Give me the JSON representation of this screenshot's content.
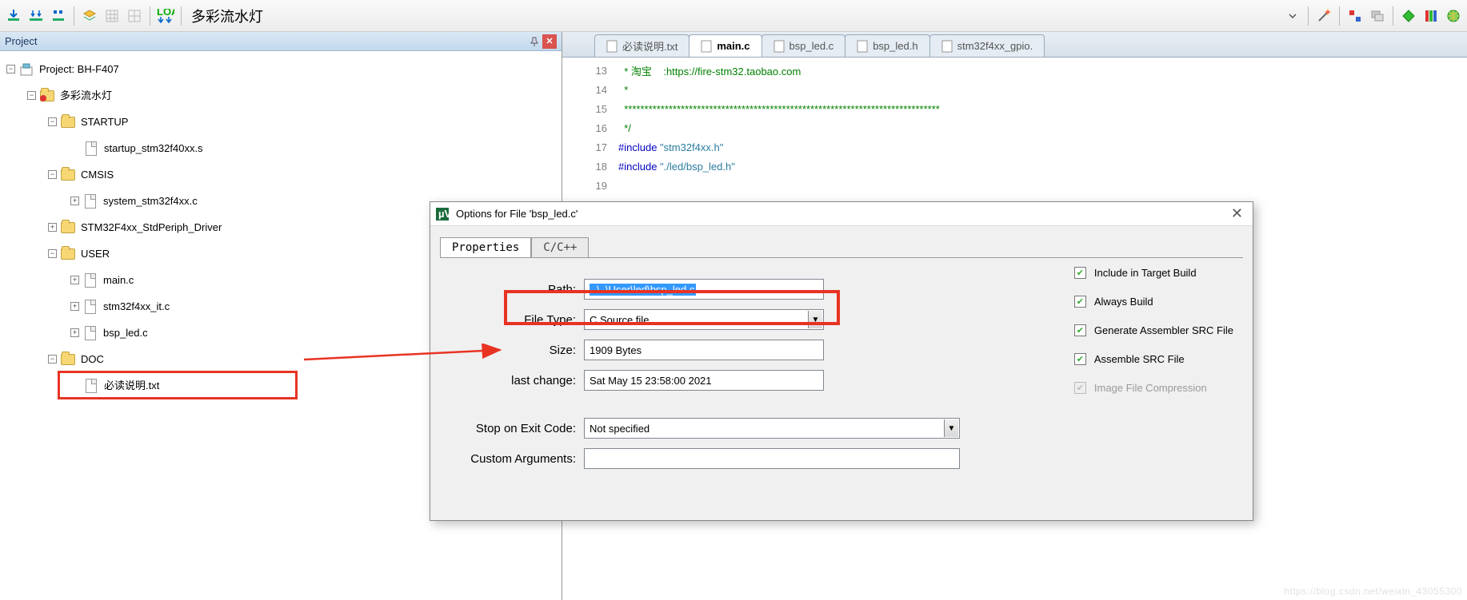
{
  "toolbar": {
    "title": "多彩流水灯"
  },
  "project": {
    "panel_title": "Project",
    "root": "Project: BH-F407",
    "target": "多彩流水灯",
    "groups": {
      "startup": {
        "name": "STARTUP",
        "files": [
          "startup_stm32f40xx.s"
        ]
      },
      "cmsis": {
        "name": "CMSIS",
        "files": [
          "system_stm32f4xx.c"
        ]
      },
      "stdperiph": {
        "name": "STM32F4xx_StdPeriph_Driver"
      },
      "user": {
        "name": "USER",
        "files": [
          "main.c",
          "stm32f4xx_it.c",
          "bsp_led.c"
        ]
      },
      "doc": {
        "name": "DOC",
        "files": [
          "必读说明.txt"
        ]
      }
    }
  },
  "tabs": [
    {
      "label": "必读说明.txt"
    },
    {
      "label": "main.c",
      "active": true
    },
    {
      "label": "bsp_led.c"
    },
    {
      "label": "bsp_led.h"
    },
    {
      "label": "stm32f4xx_gpio."
    }
  ],
  "code": {
    "lines": [
      {
        "n": 13,
        "cls": "c-green",
        "text": "  * 淘宝    :https://fire-stm32.taobao.com"
      },
      {
        "n": 14,
        "cls": "c-green",
        "text": "  *"
      },
      {
        "n": 15,
        "cls": "c-green",
        "text": "  ******************************************************************************"
      },
      {
        "n": 16,
        "cls": "c-green",
        "text": "  */"
      },
      {
        "n": 17,
        "cls": "",
        "text": "#include \"stm32f4xx.h\""
      },
      {
        "n": 18,
        "cls": "",
        "text": "#include \"./led/bsp_led.h\""
      },
      {
        "n": 19,
        "cls": "",
        "text": ""
      }
    ]
  },
  "dialog": {
    "title": "Options for File 'bsp_led.c'",
    "tabs": {
      "properties": "Properties",
      "ccpp": "C/C++"
    },
    "labels": {
      "path": "Path:",
      "filetype": "File Type:",
      "size": "Size:",
      "lastchange": "last change:",
      "stopexit": "Stop on Exit Code:",
      "customargs": "Custom Arguments:"
    },
    "values": {
      "path": "..\\..\\User\\led\\bsp_led.c",
      "filetype": "C Source file",
      "size": "1909 Bytes",
      "lastchange": "Sat May 15 23:58:00 2021",
      "stopexit": "Not specified"
    },
    "checks": {
      "include_target": "Include in Target Build",
      "always_build": "Always Build",
      "gen_asm": "Generate Assembler SRC File",
      "asm_src": "Assemble SRC File",
      "img_comp": "Image File Compression"
    }
  },
  "watermark": "https://blog.csdn.net/weixin_43055300"
}
